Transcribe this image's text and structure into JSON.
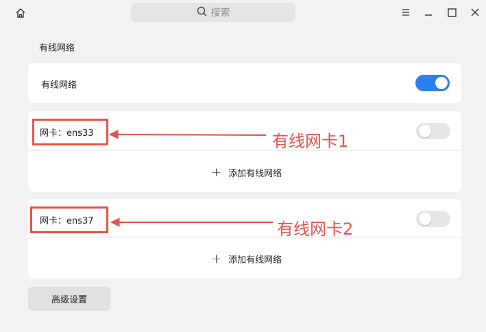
{
  "titlebar": {
    "search_placeholder": "搜索",
    "icons": [
      "home-icon",
      "search-icon",
      "menu-icon",
      "minimize-icon",
      "maximize-icon",
      "close-icon"
    ]
  },
  "section": {
    "title": "有线网络"
  },
  "wired": {
    "label": "有线网络",
    "enabled": true
  },
  "adapters": [
    {
      "label": "网卡：ens33",
      "enabled": false,
      "add_label": "添加有线网络"
    },
    {
      "label": "网卡：ens37",
      "enabled": false,
      "add_label": "添加有线网络"
    }
  ],
  "annotations": [
    "有线网卡1",
    "有线网卡2"
  ],
  "advanced_button": "高级设置",
  "colors": {
    "accent": "#2b7ff0",
    "annotation": "#e8524a",
    "background": "#f2f2f2",
    "card": "#ffffff"
  }
}
